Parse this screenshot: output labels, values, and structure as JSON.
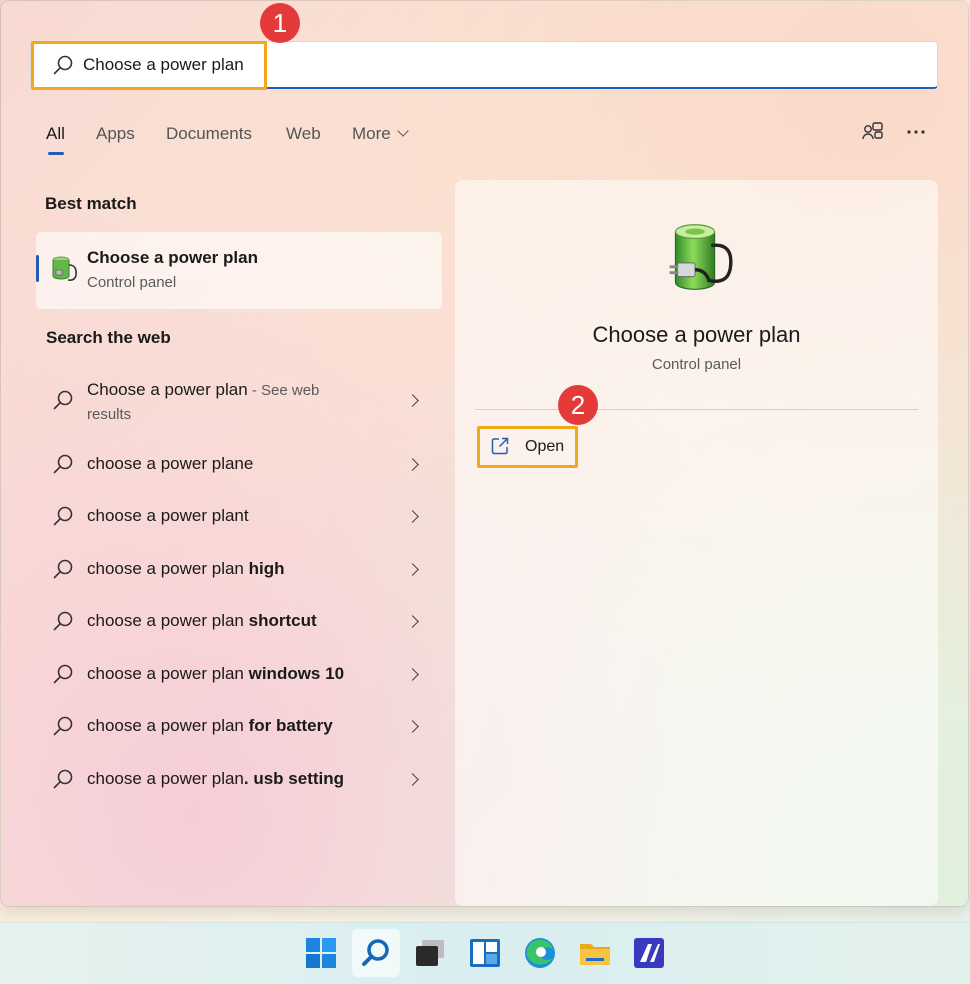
{
  "search": {
    "query": "Choose a power plan"
  },
  "tabs": [
    {
      "label": "All"
    },
    {
      "label": "Apps"
    },
    {
      "label": "Documents"
    },
    {
      "label": "Web"
    },
    {
      "label": "More"
    }
  ],
  "annotations": {
    "step1": "1",
    "step2": "2"
  },
  "best_match": {
    "section_title": "Best match",
    "title": "Choose a power plan",
    "subtitle": "Control panel"
  },
  "web": {
    "section_title": "Search the web",
    "items": [
      {
        "text": "Choose a power plan",
        "suffix": " - See web",
        "suffix2": "results"
      },
      {
        "text": "choose a power plane",
        "bold": ""
      },
      {
        "text": "choose a power plant",
        "bold": ""
      },
      {
        "text": "choose a power plan ",
        "bold": "high"
      },
      {
        "text": "choose a power plan ",
        "bold": "shortcut"
      },
      {
        "text": "choose a power plan ",
        "bold": "windows 10"
      },
      {
        "text": "choose a power plan ",
        "bold": "for battery"
      },
      {
        "text": "choose a power plan",
        "bold": ". usb setting"
      }
    ]
  },
  "details": {
    "title": "Choose a power plan",
    "subtitle": "Control panel",
    "open_label": "Open"
  },
  "colors": {
    "accent": "#1f5fb5",
    "highlight": "#f0a91b",
    "badge": "#e53a3a"
  },
  "taskbar": {
    "icons": [
      "windows-start-icon",
      "search-icon",
      "task-view-icon",
      "widgets-icon",
      "edge-icon",
      "file-explorer-icon",
      "app-icon"
    ]
  }
}
